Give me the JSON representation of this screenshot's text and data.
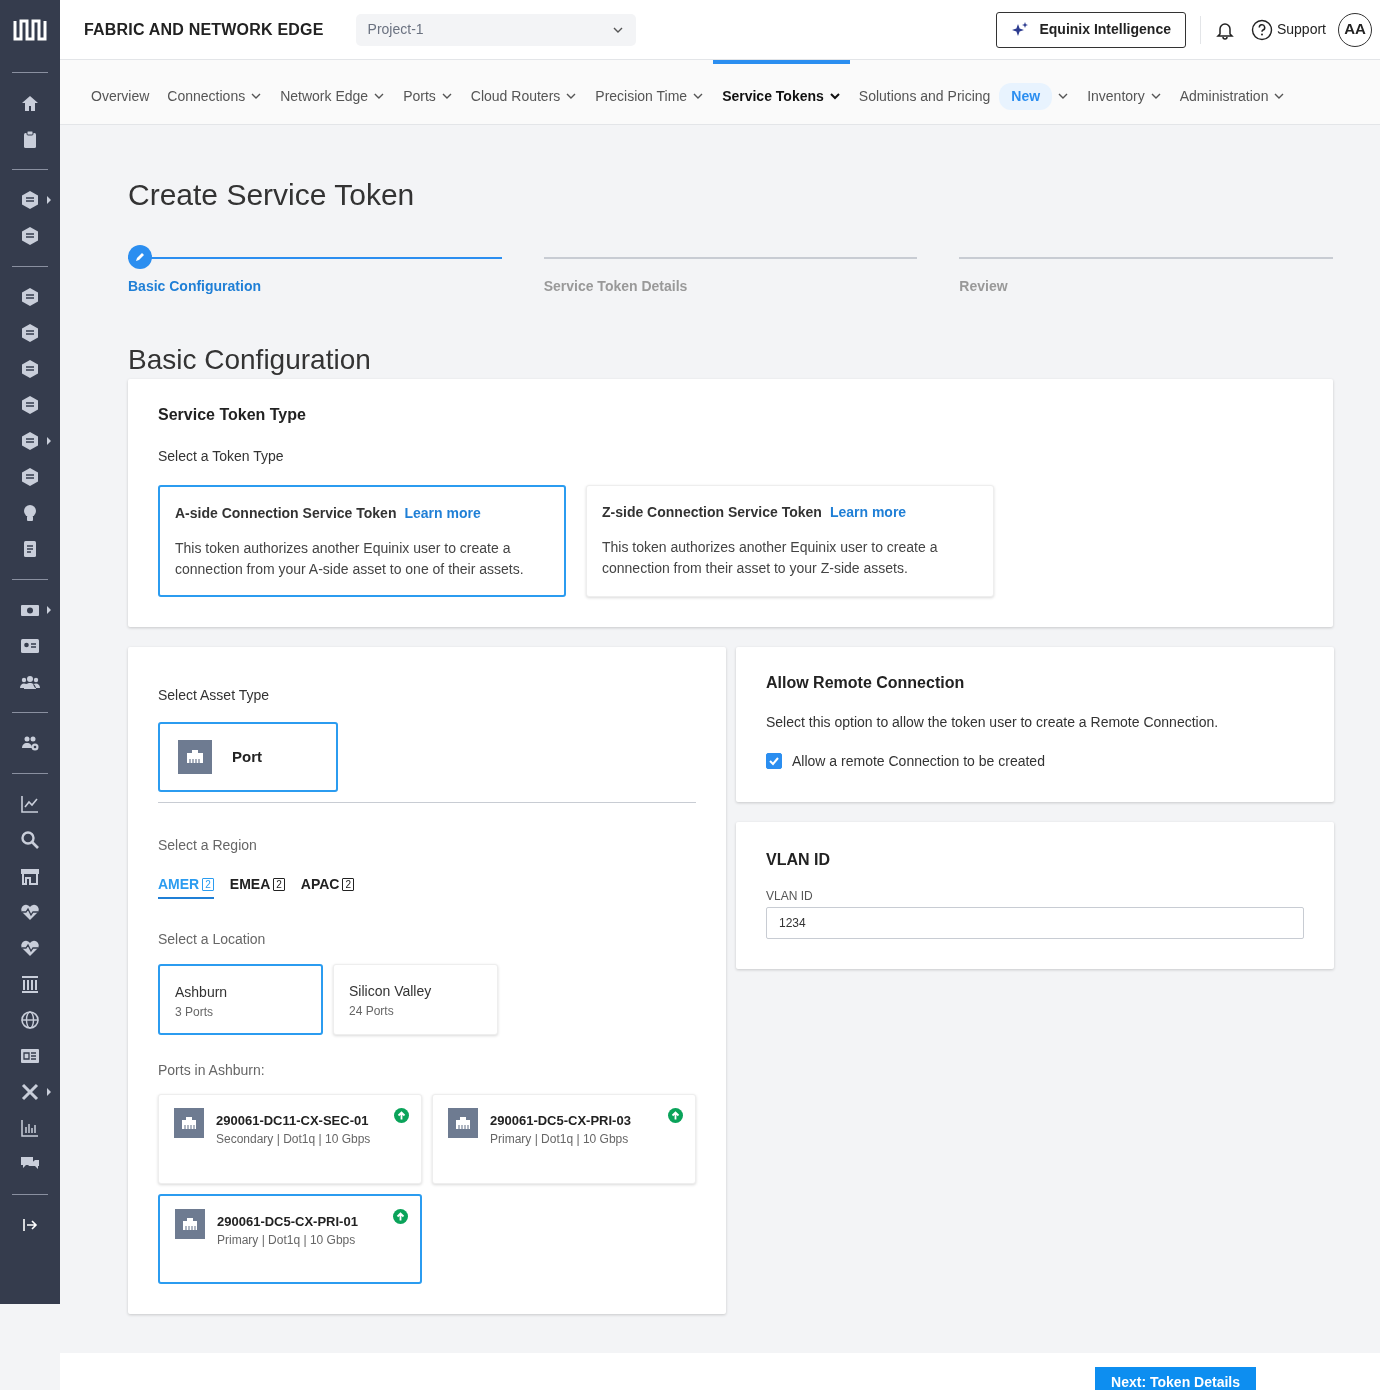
{
  "app": {
    "title": "FABRIC AND NETWORK EDGE",
    "project": "Project-1"
  },
  "header": {
    "ai_button": "Equinix Intelligence",
    "support": "Support",
    "avatar": "AA"
  },
  "nav": [
    {
      "label": "Overview",
      "dropdown": false,
      "selected": false
    },
    {
      "label": "Connections",
      "dropdown": true,
      "selected": false
    },
    {
      "label": "Network Edge",
      "dropdown": true,
      "selected": false
    },
    {
      "label": "Ports",
      "dropdown": true,
      "selected": false
    },
    {
      "label": "Cloud Routers",
      "dropdown": true,
      "selected": false
    },
    {
      "label": "Precision Time",
      "dropdown": true,
      "selected": false
    },
    {
      "label": "Service Tokens",
      "dropdown": true,
      "selected": true
    },
    {
      "label": "Solutions and Pricing",
      "badge": "New",
      "dropdown": true,
      "selected": false
    },
    {
      "label": "Inventory",
      "dropdown": true,
      "selected": false
    },
    {
      "label": "Administration",
      "dropdown": true,
      "selected": false
    }
  ],
  "sidebar": {
    "groups": [
      [
        {
          "submenu": false
        },
        {
          "submenu": false
        }
      ],
      [
        {
          "submenu": true
        },
        {
          "submenu": false
        }
      ],
      [
        {
          "submenu": false
        },
        {
          "submenu": false
        },
        {
          "submenu": false
        },
        {
          "submenu": false
        },
        {
          "submenu": true
        },
        {
          "submenu": false
        },
        {
          "submenu": false
        },
        {
          "submenu": false
        }
      ],
      [
        {
          "submenu": true
        },
        {
          "submenu": false
        },
        {
          "submenu": false
        }
      ],
      [
        {
          "submenu": false
        }
      ],
      [
        {
          "submenu": false
        },
        {
          "submenu": false
        },
        {
          "submenu": false
        },
        {
          "submenu": false
        },
        {
          "submenu": false
        },
        {
          "submenu": false
        },
        {
          "submenu": false
        },
        {
          "submenu": false
        },
        {
          "submenu": true
        },
        {
          "submenu": false
        },
        {
          "submenu": false
        }
      ]
    ]
  },
  "page_title": "Create Service Token",
  "steps": [
    {
      "label": "Basic Configuration",
      "selected": true
    },
    {
      "label": "Service Token Details",
      "selected": false
    },
    {
      "label": "Review",
      "selected": false
    }
  ],
  "section_title": "Basic Configuration",
  "token_type": {
    "title": "Service Token Type",
    "prompt": "Select a Token Type",
    "options": [
      {
        "title": "A-side Connection Service Token",
        "link": "Learn more",
        "description": "This token authorizes another Equinix user to create a connection from your A-side asset to one of their assets.",
        "selected": true
      },
      {
        "title": "Z-side Connection Service Token",
        "link": "Learn more",
        "description": "This token authorizes another Equinix user to create a connection from their asset to your Z-side assets.",
        "selected": false
      }
    ]
  },
  "asset": {
    "prompt": "Select Asset Type",
    "options": [
      {
        "label": "Port",
        "selected": true
      }
    ]
  },
  "region": {
    "prompt": "Select a Region",
    "tabs": [
      {
        "label": "AMER",
        "count": "2",
        "selected": true
      },
      {
        "label": "EMEA",
        "count": "2",
        "selected": false
      },
      {
        "label": "APAC",
        "count": "2",
        "selected": false
      }
    ]
  },
  "location": {
    "prompt": "Select a Location",
    "options": [
      {
        "name": "Ashburn",
        "detail": "3 Ports",
        "selected": true
      },
      {
        "name": "Silicon Valley",
        "detail": "24 Ports",
        "selected": false
      }
    ]
  },
  "ports": {
    "title": "Ports in Ashburn:",
    "items": [
      {
        "name": "290061-DC11-CX-SEC-01",
        "detail": "Secondary | Dot1q | 10 Gbps",
        "up": true,
        "selected": false
      },
      {
        "name": "290061-DC5-CX-PRI-03",
        "detail": "Primary | Dot1q | 10 Gbps",
        "up": true,
        "selected": false
      },
      {
        "name": "290061-DC5-CX-PRI-01",
        "detail": "Primary | Dot1q | 10 Gbps",
        "up": true,
        "selected": true
      }
    ]
  },
  "remote": {
    "title": "Allow Remote Connection",
    "description": "Select this option to allow the token user to create a Remote Connection.",
    "checkbox": {
      "label": "Allow a remote Connection to be created",
      "checked": true
    }
  },
  "vlan": {
    "title": "VLAN ID",
    "label": "VLAN ID",
    "value": "1234"
  },
  "footer": {
    "next": "Next: Token Details"
  }
}
